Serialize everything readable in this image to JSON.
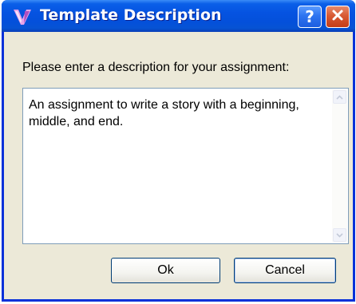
{
  "dialog": {
    "title": "Template Description",
    "help_icon": "help-icon",
    "close_icon": "close-icon",
    "app_icon": "app-icon",
    "help_label": "?"
  },
  "form": {
    "prompt": "Please enter a description for your assignment:",
    "description_value": "An assignment to write a story with a beginning, middle, and end."
  },
  "buttons": {
    "ok_label": "Ok",
    "cancel_label": "Cancel"
  },
  "colors": {
    "titlebar": "#0553e1",
    "window_bg": "#ece9d8",
    "close": "#c43d17",
    "field_border": "#7f9db9"
  }
}
